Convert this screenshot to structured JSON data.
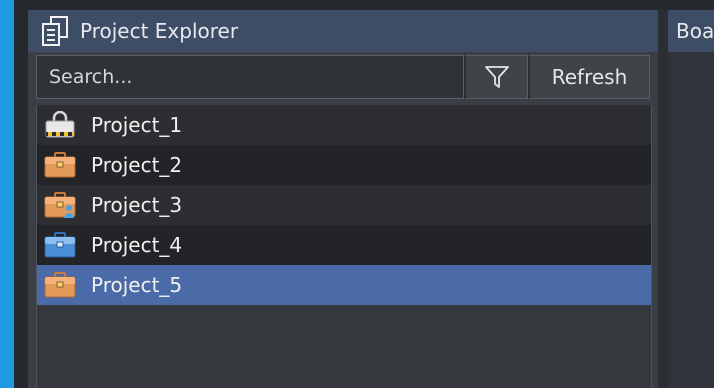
{
  "project_explorer": {
    "title": "Project Explorer",
    "icon": "project-explorer-icon",
    "search": {
      "placeholder": "Search...",
      "value": ""
    },
    "filter_icon": "filter-icon",
    "refresh_label": "Refresh",
    "projects": [
      {
        "label": "Project_1",
        "icon": "locked-project-icon",
        "selected": false
      },
      {
        "label": "Project_2",
        "icon": "briefcase-icon",
        "selected": false
      },
      {
        "label": "Project_3",
        "icon": "shared-briefcase-icon",
        "selected": false
      },
      {
        "label": "Project_4",
        "icon": "blue-briefcase-icon",
        "selected": false
      },
      {
        "label": "Project_5",
        "icon": "briefcase-icon",
        "selected": true
      }
    ]
  },
  "right_panel": {
    "title": "Boa"
  },
  "colors": {
    "accent": "#1e9be0",
    "header": "#3e4d66",
    "selection": "#4a6ba8"
  }
}
